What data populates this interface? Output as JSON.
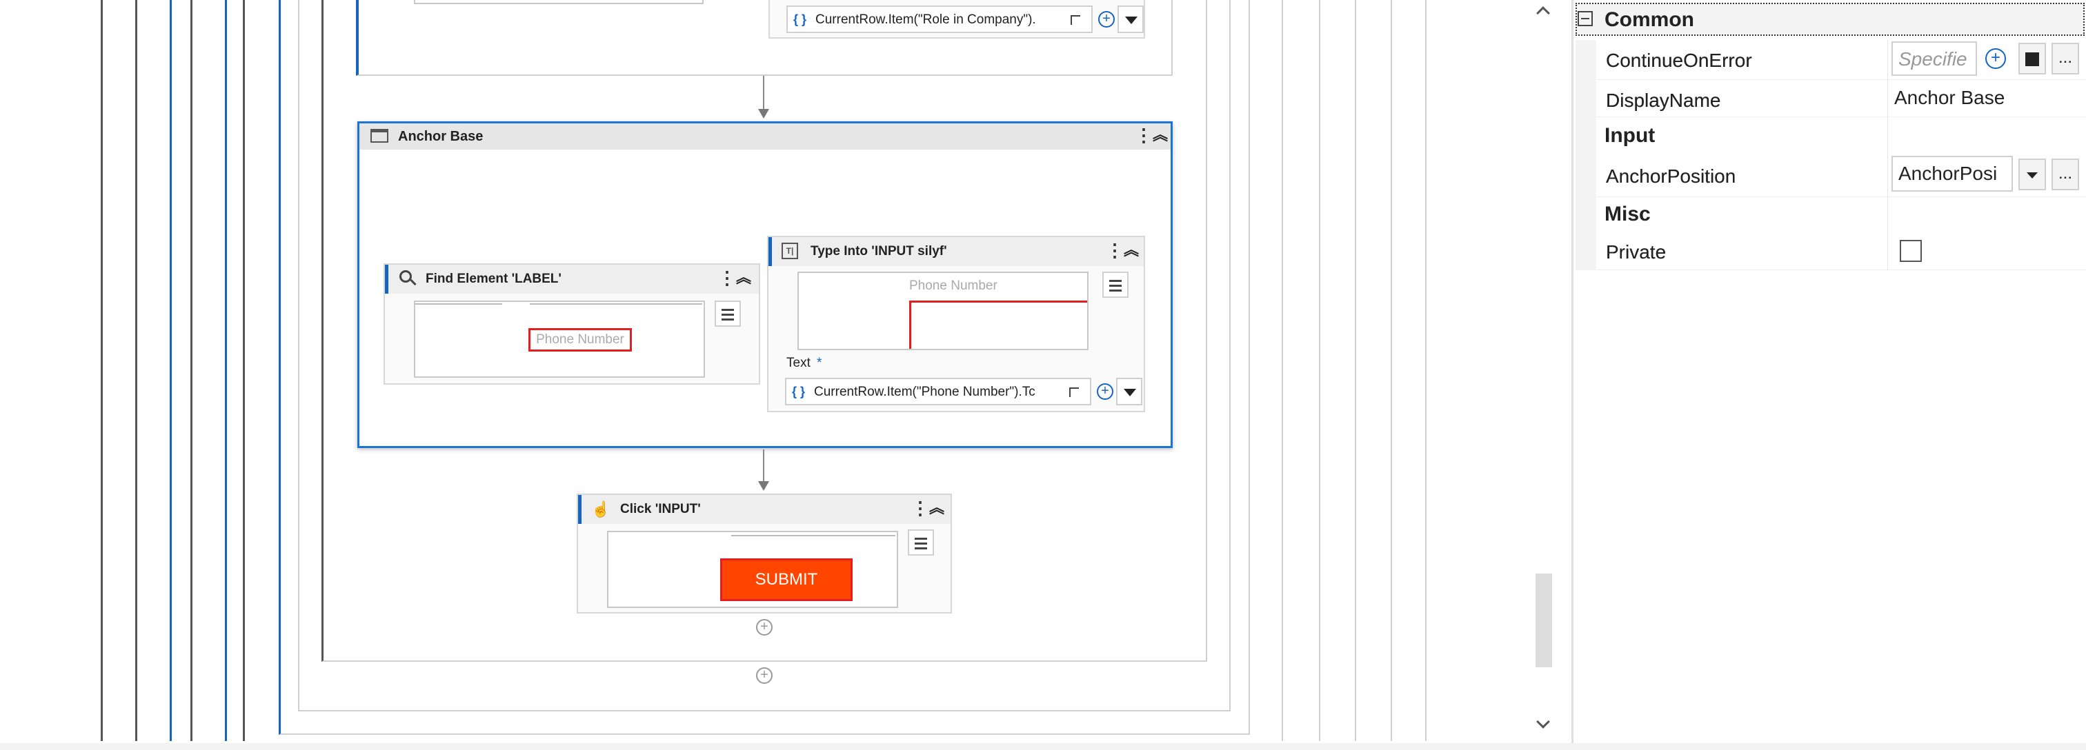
{
  "colors": {
    "accent": "#1565c0",
    "submit_bg": "#ff4500",
    "highlight_red": "#e02020",
    "line_dark": "#555555",
    "line_blue": "#1565c0"
  },
  "designer": {
    "top_partial": {
      "expression": "CurrentRow.Item(\"Role in Company\")."
    },
    "anchor_base": {
      "title": "Anchor Base",
      "icon": "window-icon"
    },
    "find_element": {
      "title": "Find Element 'LABEL'",
      "icon": "search-icon",
      "preview_label": "Phone Number"
    },
    "type_into": {
      "title": "Type Into 'INPUT  silyf'",
      "icon": "type-into-icon",
      "preview_label": "Phone Number",
      "text_label": "Text",
      "required_mark": "*",
      "expression": "CurrentRow.Item(\"Phone Number\").Tc"
    },
    "click_input": {
      "title": "Click 'INPUT'",
      "icon": "click-icon",
      "submit_label": "SUBMIT"
    }
  },
  "properties": {
    "categories": [
      {
        "name": "Common",
        "rows": [
          {
            "name": "ContinueOnError",
            "value": "Specifie",
            "placeholder": true
          },
          {
            "name": "DisplayName",
            "value": "Anchor Base"
          }
        ]
      },
      {
        "name": "Input",
        "rows": [
          {
            "name": "AnchorPosition",
            "value": "AnchorPosi"
          }
        ]
      },
      {
        "name": "Misc",
        "rows": [
          {
            "name": "Private",
            "value": "",
            "checkbox": true,
            "checked": false
          }
        ]
      }
    ],
    "ellipsis_label": "...",
    "plus_symbol": "+"
  }
}
